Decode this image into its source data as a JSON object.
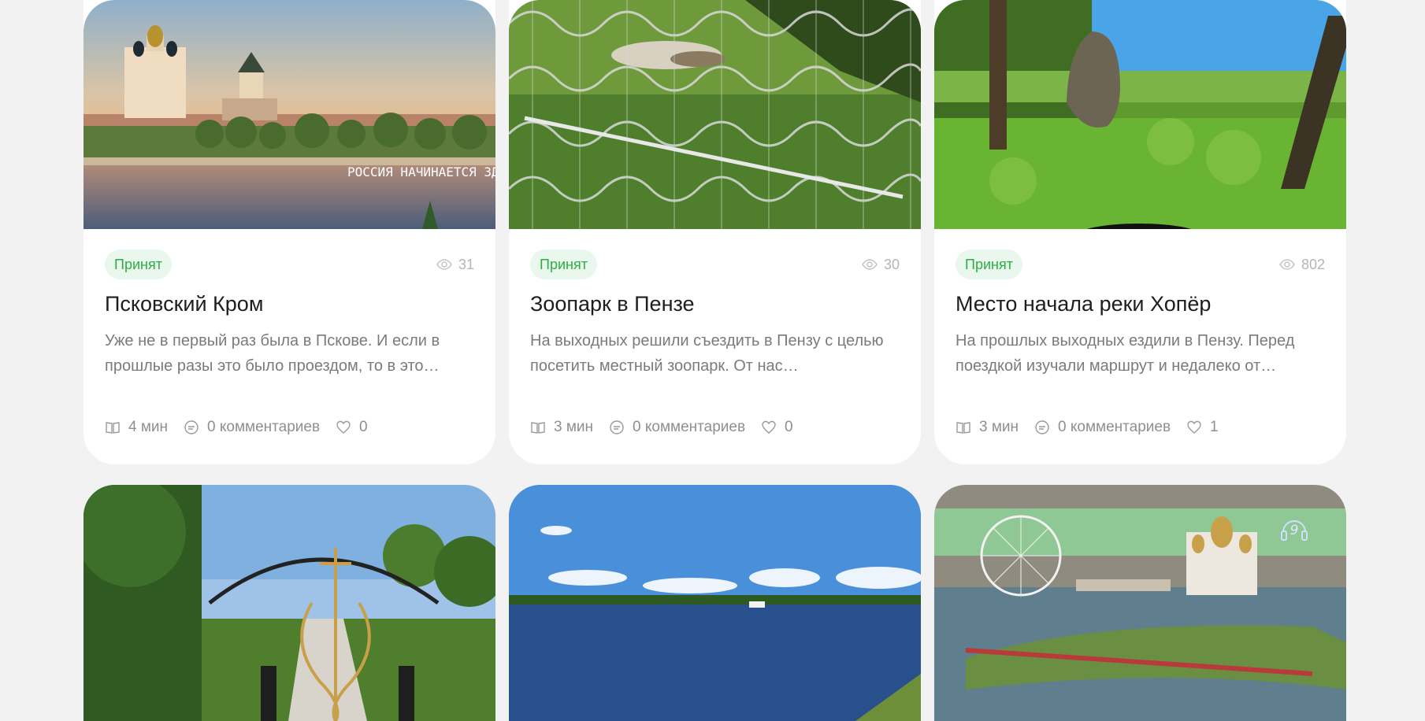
{
  "cards": [
    {
      "status": "Принят",
      "views": "31",
      "title": "Псковский Кром",
      "excerpt": "Уже не в первый раз была в Пскове. И если в прошлые разы это было проездом, то в это…",
      "read_time": "4 мин",
      "comments": "0 комментариев",
      "likes": "0",
      "image_caption": "РОССИЯ НАЧИНАЕТСЯ ЗДЕСЬ"
    },
    {
      "status": "Принят",
      "views": "30",
      "title": "Зоопарк в Пензе",
      "excerpt": "На выходных решили съездить в Пензу с целью посетить местный зоопарк. От нас…",
      "read_time": "3 мин",
      "comments": "0 комментариев",
      "likes": "0"
    },
    {
      "status": "Принят",
      "views": "802",
      "title": "Место начала реки Хопёр",
      "excerpt": "На прошлых выходных ездили в Пензу. Перед поездкой изучали маршрут и недалеко от…",
      "read_time": "3 мин",
      "comments": "0 комментариев",
      "likes": "1"
    }
  ],
  "row2_badge": "9",
  "colors": {
    "background": "#f2f2f2",
    "card": "#ffffff",
    "badge_bg": "#eaf7ec",
    "badge_text": "#2dae45",
    "title": "#1e1e1e",
    "excerpt": "#7b7b7b",
    "meta": "#8f8f8f"
  },
  "icons": [
    "eye-icon",
    "book-icon",
    "comment-icon",
    "heart-icon",
    "audio-headphones-icon"
  ]
}
